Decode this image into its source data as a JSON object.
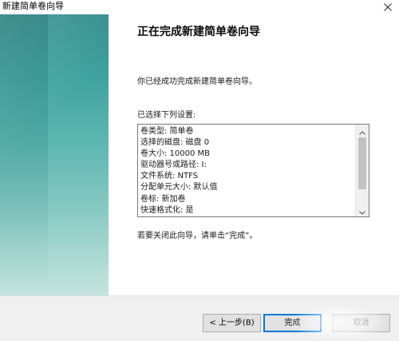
{
  "window": {
    "title": "新建简单卷向导"
  },
  "content": {
    "heading": "正在完成新建简单卷向导",
    "description": "你已经成功完成新建简单卷向导。",
    "settings_label": "已选择下列设置:",
    "settings": [
      "卷类型: 简单卷",
      "选择的磁盘: 磁盘 0",
      "卷大小: 10000 MB",
      "驱动器号或路径: I:",
      "文件系统: NTFS",
      "分配单元大小: 默认值",
      "卷标: 新加卷",
      "快速格式化: 是"
    ],
    "scrollbar": {
      "position": 0
    },
    "close_hint": "若要关闭此向导，请单击“完成”。"
  },
  "buttons": {
    "back_label": "< 上一步(B)",
    "finish_label": "完成",
    "cancel_label": "取消"
  },
  "icons": {
    "close": "close-icon",
    "scroll_up": "chevron-up-icon",
    "scroll_down": "chevron-down-icon"
  },
  "colors": {
    "banner_top": "#2f8c8a",
    "banner_bottom": "#c4e4de",
    "default_button_border": "#0078d7",
    "footer_bg": "#f0f0f0"
  }
}
